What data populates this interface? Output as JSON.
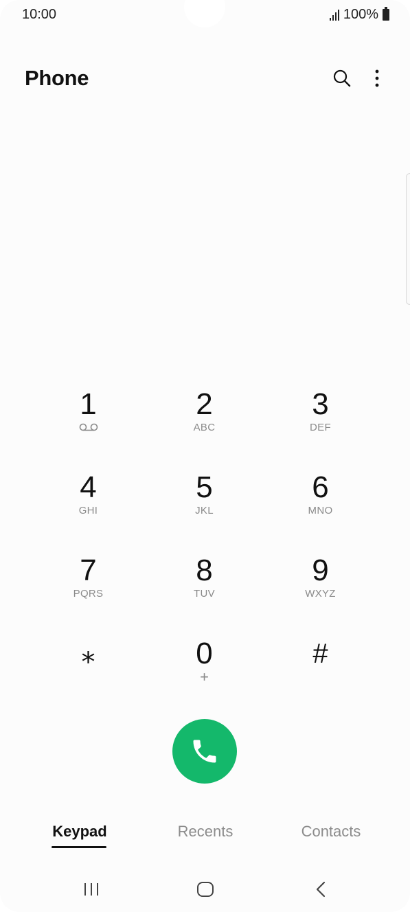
{
  "status_bar": {
    "time": "10:00",
    "battery": "100%"
  },
  "header": {
    "title": "Phone",
    "icons": [
      "search-icon",
      "more-options-icon"
    ]
  },
  "keypad": {
    "keys": [
      {
        "digit": "1",
        "letters": "",
        "icon": "voicemail-icon"
      },
      {
        "digit": "2",
        "letters": "ABC"
      },
      {
        "digit": "3",
        "letters": "DEF"
      },
      {
        "digit": "4",
        "letters": "GHI"
      },
      {
        "digit": "5",
        "letters": "JKL"
      },
      {
        "digit": "6",
        "letters": "MNO"
      },
      {
        "digit": "7",
        "letters": "PQRS"
      },
      {
        "digit": "8",
        "letters": "TUV"
      },
      {
        "digit": "9",
        "letters": "WXYZ"
      },
      {
        "digit": "⁎",
        "letters": ""
      },
      {
        "digit": "0",
        "letters": "+"
      },
      {
        "digit": "#",
        "letters": ""
      }
    ]
  },
  "call_button": {
    "icon": "phone-icon",
    "color": "#14b86b"
  },
  "tabs": [
    {
      "label": "Keypad",
      "selected": true
    },
    {
      "label": "Recents",
      "selected": false
    },
    {
      "label": "Contacts",
      "selected": false
    }
  ],
  "nav_bar": {
    "icons": [
      "recent-apps-icon",
      "home-icon",
      "back-icon"
    ]
  }
}
